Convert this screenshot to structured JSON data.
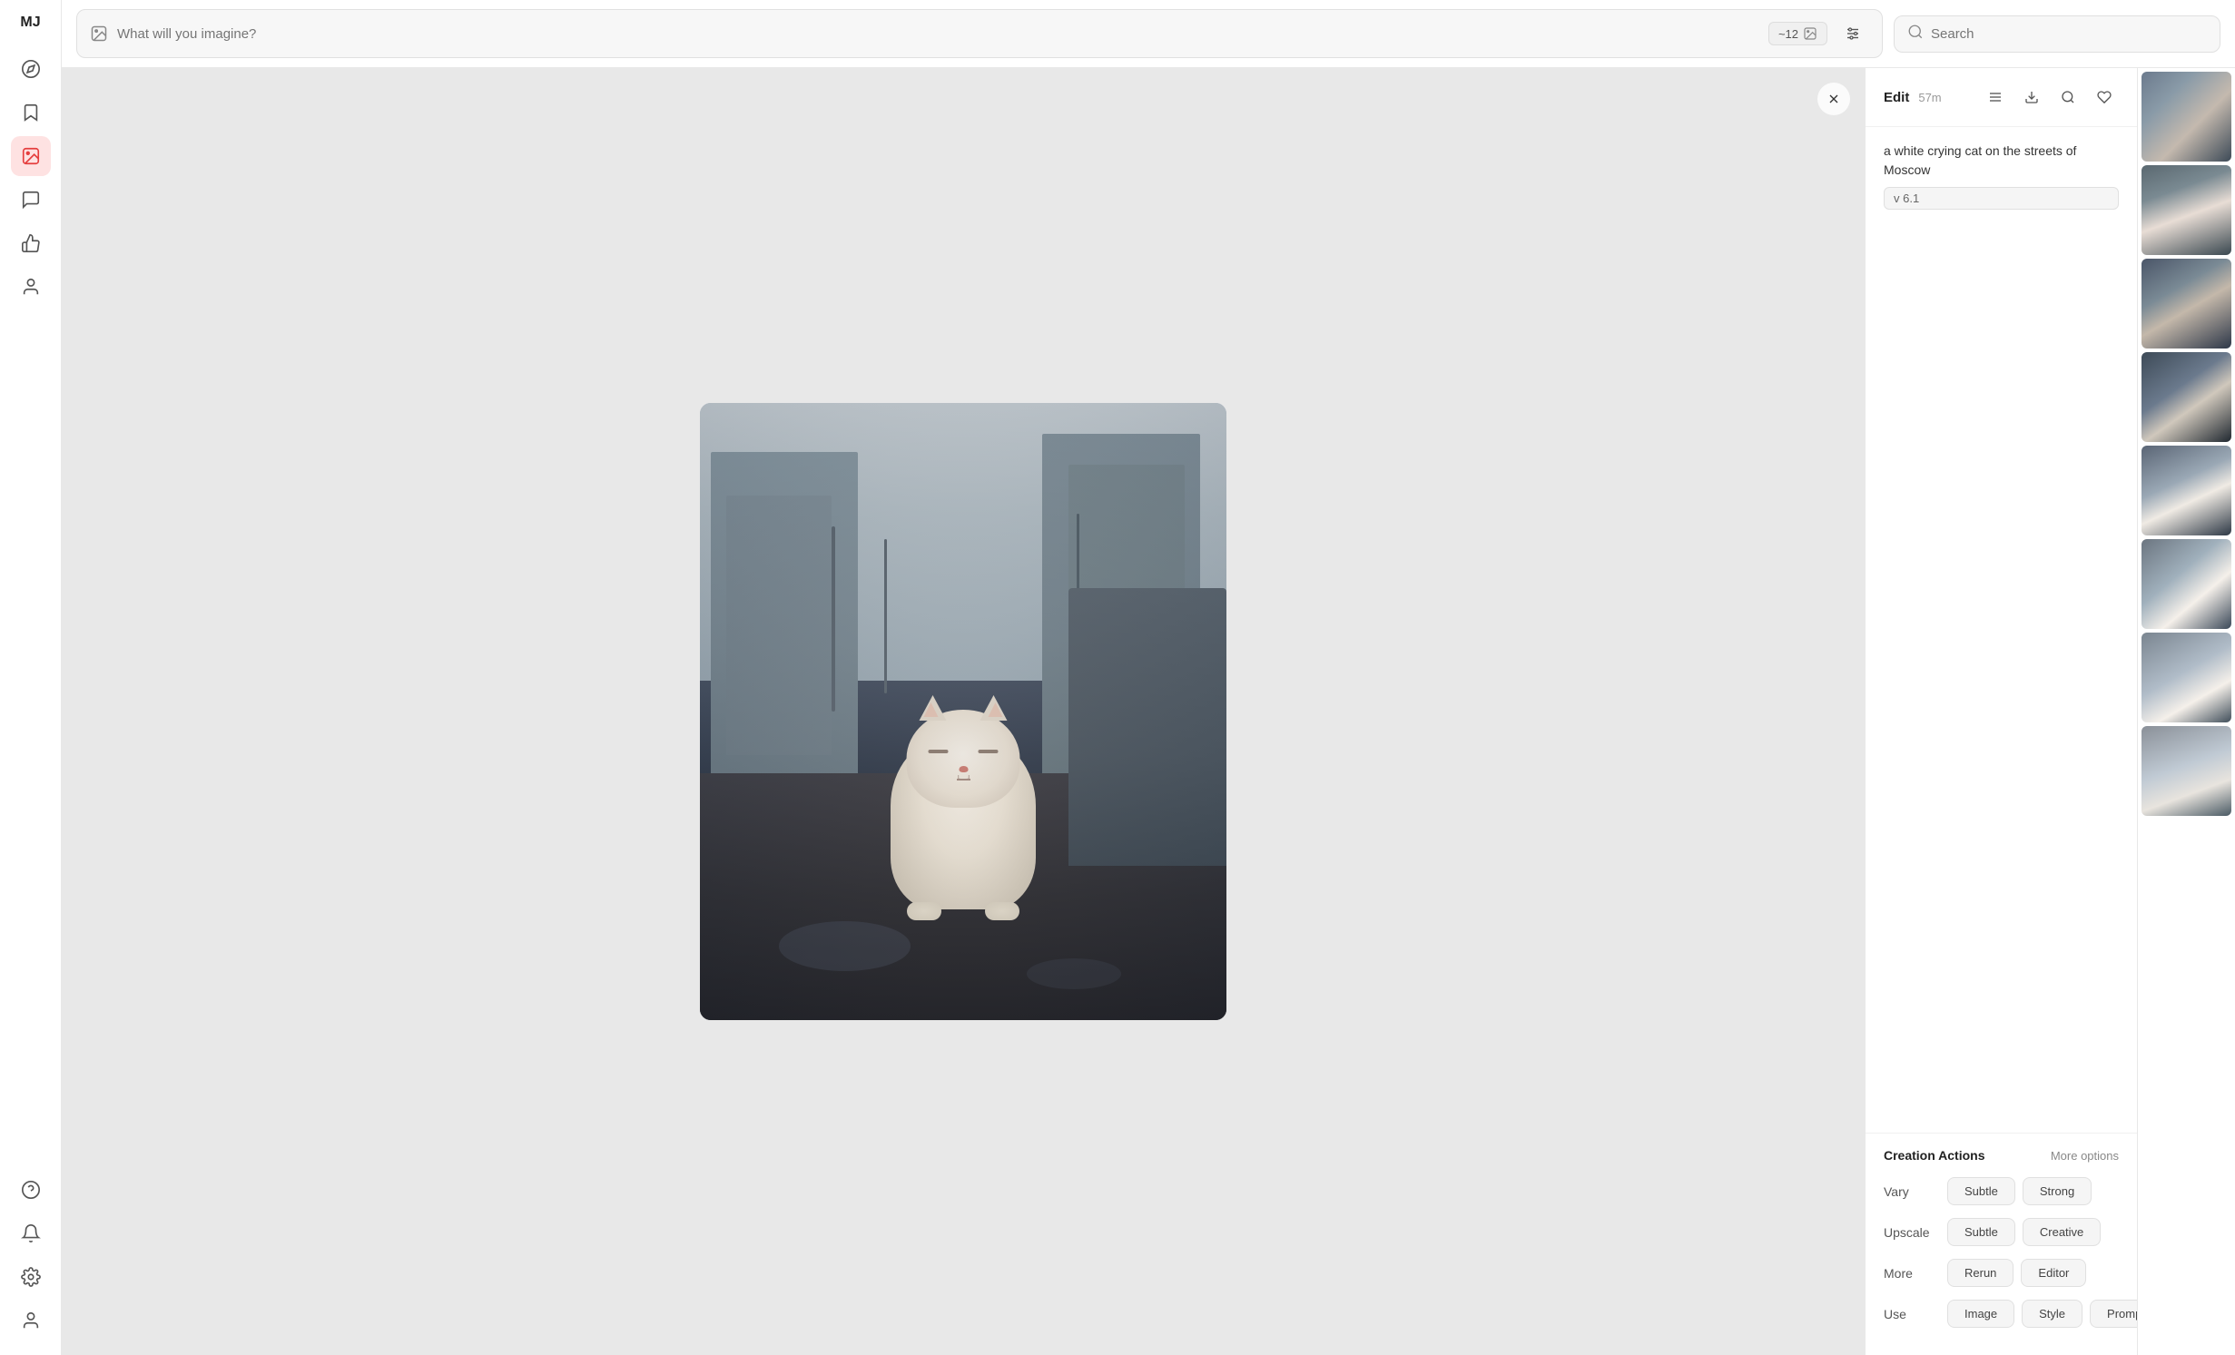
{
  "app": {
    "logo": "MJ"
  },
  "topbar": {
    "prompt_placeholder": "What will you imagine?",
    "token_count": "~12",
    "search_placeholder": "Search"
  },
  "sidebar": {
    "items": [
      {
        "id": "compass",
        "label": "Explore",
        "icon": "◎",
        "active": false
      },
      {
        "id": "bookmark",
        "label": "Bookmarks",
        "icon": "⊟",
        "active": false
      },
      {
        "id": "images",
        "label": "Images",
        "icon": "▣",
        "active": true
      },
      {
        "id": "chat",
        "label": "Chat",
        "icon": "◻",
        "active": false
      },
      {
        "id": "like",
        "label": "Liked",
        "icon": "⊕",
        "active": false
      },
      {
        "id": "profile",
        "label": "Profile",
        "icon": "○",
        "active": false
      }
    ],
    "bottom_items": [
      {
        "id": "help",
        "label": "Help",
        "icon": "?"
      },
      {
        "id": "notifications",
        "label": "Notifications",
        "icon": "🔔"
      },
      {
        "id": "settings",
        "label": "Settings",
        "icon": "✦"
      },
      {
        "id": "account",
        "label": "Account",
        "icon": "○"
      }
    ]
  },
  "detail_panel": {
    "edit_label": "Edit",
    "time": "57m",
    "prompt_text": "a white crying cat on the streets of Moscow",
    "version": "v 6.1",
    "actions": {
      "title": "Creation Actions",
      "more_options": "More options",
      "rows": [
        {
          "label": "Vary",
          "buttons": [
            "Subtle",
            "Strong"
          ]
        },
        {
          "label": "Upscale",
          "buttons": [
            "Subtle",
            "Creative"
          ]
        },
        {
          "label": "More",
          "buttons": [
            "Rerun",
            "Editor"
          ]
        },
        {
          "label": "Use",
          "buttons": [
            "Image",
            "Style",
            "Prompt"
          ]
        }
      ]
    }
  },
  "thumbnails": [
    {
      "id": 1,
      "class": "thumb-1"
    },
    {
      "id": 2,
      "class": "thumb-2"
    },
    {
      "id": 3,
      "class": "thumb-3"
    },
    {
      "id": 4,
      "class": "thumb-4"
    },
    {
      "id": 5,
      "class": "thumb-5"
    },
    {
      "id": 6,
      "class": "thumb-6"
    },
    {
      "id": 7,
      "class": "thumb-7"
    },
    {
      "id": 8,
      "class": "thumb-8"
    }
  ]
}
